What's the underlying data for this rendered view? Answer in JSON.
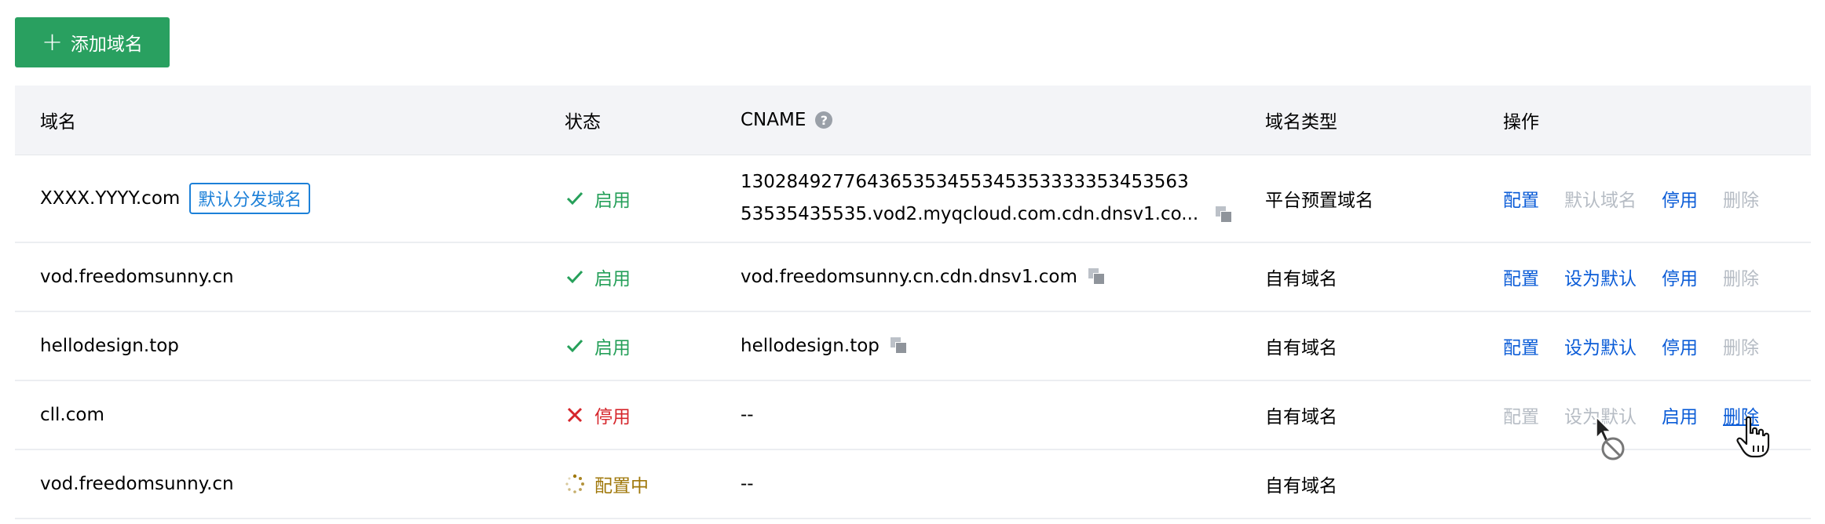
{
  "toolbar": {
    "add_label": "添加域名"
  },
  "table": {
    "headers": {
      "domain": "域名",
      "status": "状态",
      "cname": "CNAME",
      "type": "域名类型",
      "ops": "操作"
    },
    "rows": [
      {
        "domain": "XXXX.YYYY.com",
        "badge": "默认分发域名",
        "status": "启用",
        "cname_line1": "130284927764365353455345353333353453563",
        "cname_line2": "53535435535.vod2.myqcloud.com.cdn.dnsv1.co...",
        "type": "平台预置域名",
        "ops": [
          "配置",
          "默认域名",
          "停用",
          "删除"
        ]
      },
      {
        "domain": "vod.freedomsunny.cn",
        "status": "启用",
        "cname": "vod.freedomsunny.cn.cdn.dnsv1.com",
        "type": "自有域名",
        "ops": [
          "配置",
          "设为默认",
          "停用",
          "删除"
        ]
      },
      {
        "domain": "hellodesign.top",
        "status": "启用",
        "cname": "hellodesign.top",
        "type": "自有域名",
        "ops": [
          "配置",
          "设为默认",
          "停用",
          "删除"
        ]
      },
      {
        "domain": "cll.com",
        "status": "停用",
        "cname": "--",
        "type": "自有域名",
        "ops": [
          "配置",
          "设为默认",
          "启用",
          "删除"
        ]
      },
      {
        "domain": "vod.freedomsunny.cn",
        "status": "配置中",
        "cname": "--",
        "type": "自有域名"
      }
    ]
  },
  "colors": {
    "primary_green": "#29a060",
    "link_blue": "#0b5cd7",
    "error_red": "#d6262c",
    "pending_gold": "#a0780b"
  }
}
